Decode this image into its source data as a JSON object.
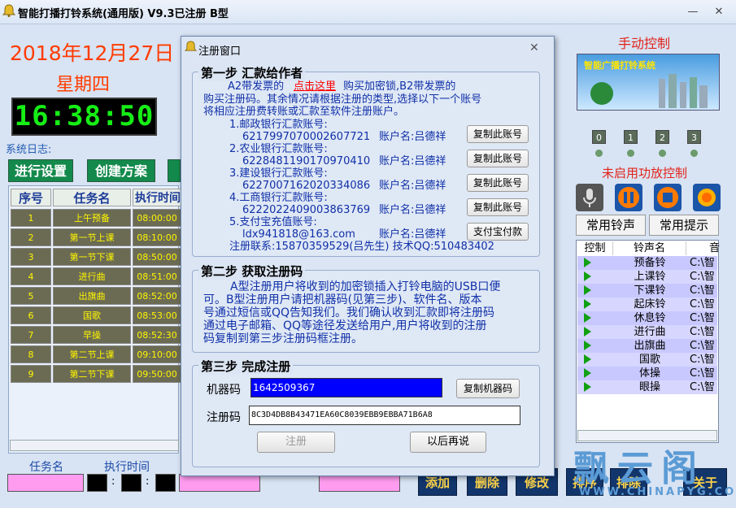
{
  "app": {
    "title": "智能打播打铃系统(通用版) V9.3已注册 B型"
  },
  "main": {
    "date": "2018年12月27日",
    "weekday": "星期四",
    "clock": "16:38:50",
    "syslog_label": "系统日志:",
    "buttons": {
      "settings": "进行设置",
      "create_plan": "创建方案"
    },
    "table": {
      "headers": [
        "序号",
        "任务名",
        "执行时间"
      ],
      "rows": [
        [
          "1",
          "上午预备",
          "08:00:00"
        ],
        [
          "2",
          "第一节上课",
          "08:10:00"
        ],
        [
          "3",
          "第一节下课",
          "08:50:00"
        ],
        [
          "4",
          "进行曲",
          "08:51:00"
        ],
        [
          "5",
          "出旗曲",
          "08:52:00"
        ],
        [
          "6",
          "国歌",
          "08:53:00"
        ],
        [
          "7",
          "早操",
          "08:52:30"
        ],
        [
          "8",
          "第二节上课",
          "09:10:00"
        ],
        [
          "9",
          "第二节下课",
          "09:50:00"
        ]
      ]
    },
    "bottom": {
      "task_name_label": "任务名",
      "exec_time_label": "执行时间",
      "add": "添加",
      "delete": "删除",
      "modify": "修改",
      "sort": "排序",
      "order": "排除",
      "about": "关于"
    }
  },
  "dialog": {
    "title": "注册窗口",
    "step1": {
      "title": "第一步 汇款给作者",
      "intro_a": "A2带发票的",
      "link": "点击这里",
      "intro_b": "购买加密锁,B2带发票的",
      "intro_c": "购买注册码。其余情况请根据注册的类型,选择以下一个账号",
      "intro_d": "将相应注册费转账或汇款至软件注册账户。",
      "accounts": [
        {
          "bank": "1.邮政银行汇款账号:",
          "number": "6217997070002607721",
          "holder": "账户名:吕德祥",
          "button": "复制此账号"
        },
        {
          "bank": "2.农业银行汇款账号:",
          "number": "6228481190170970410",
          "holder": "账户名:吕德祥",
          "button": "复制此账号"
        },
        {
          "bank": "3.建设银行汇款账号:",
          "number": "6227007162020334086",
          "holder": "账户名:吕德祥",
          "button": "复制此账号"
        },
        {
          "bank": "4.工商银行汇款账号:",
          "number": "6222022409003863769",
          "holder": "账户名:吕德祥",
          "button": "复制此账号"
        },
        {
          "bank": "5.支付宝充值账号:",
          "number": "ldx941818@163.com",
          "holder": "账户名:吕德祥",
          "button": "支付宝付款"
        }
      ],
      "contact": "注册联系:15870359529(吕先生) 技术QQ:510483402"
    },
    "step2": {
      "title": "第二步 获取注册码",
      "lines": [
        "A型注册用户将收到的加密锁插入打铃电脑的USB口便",
        "可。B型注册用户请把机器码(见第三步)、软件名、版本",
        "号通过短信或QQ告知我们。我们确认收到汇款即将注册码",
        "通过电子邮箱、QQ等途径发送给用户,用户将收到的注册",
        "码复制到第三步注册码框注册。"
      ]
    },
    "step3": {
      "title": "第三步 完成注册",
      "machine_label": "机器码",
      "machine_code": "1642509367",
      "copy_machine": "复制机器码",
      "reg_label": "注册码",
      "reg_code": "8C3D4DB8B43471EA60C8039EBB9EBBA71B6A8",
      "register": "注册",
      "later": "以后再说"
    }
  },
  "right": {
    "title": "手动控制",
    "banner": "智能广播打铃系统",
    "zones": [
      "0",
      "1",
      "2",
      "3"
    ],
    "amp_status": "未启用功放控制",
    "tabs": [
      "常用铃声",
      "常用提示"
    ],
    "ring_table": {
      "headers": [
        "控制",
        "铃声名",
        "音"
      ],
      "rows": [
        [
          "预备铃",
          "C:\\智"
        ],
        [
          "上课铃",
          "C:\\智"
        ],
        [
          "下课铃",
          "C:\\智"
        ],
        [
          "起床铃",
          "C:\\智"
        ],
        [
          "休息铃",
          "C:\\智"
        ],
        [
          "进行曲",
          "C:\\智"
        ],
        [
          "出旗曲",
          "C:\\智"
        ],
        [
          "国歌",
          "C:\\智"
        ],
        [
          "体操",
          "C:\\智"
        ],
        [
          "眼操",
          "C:\\智"
        ]
      ]
    }
  },
  "watermark": {
    "main": "飘云阁",
    "sub": "WWW.CHINAPYG.COM"
  },
  "colors": {
    "accent_red": "#ff3c00",
    "clock_green": "#16ee16",
    "link_red": "#ff0000",
    "text_blue": "#1030a8"
  }
}
